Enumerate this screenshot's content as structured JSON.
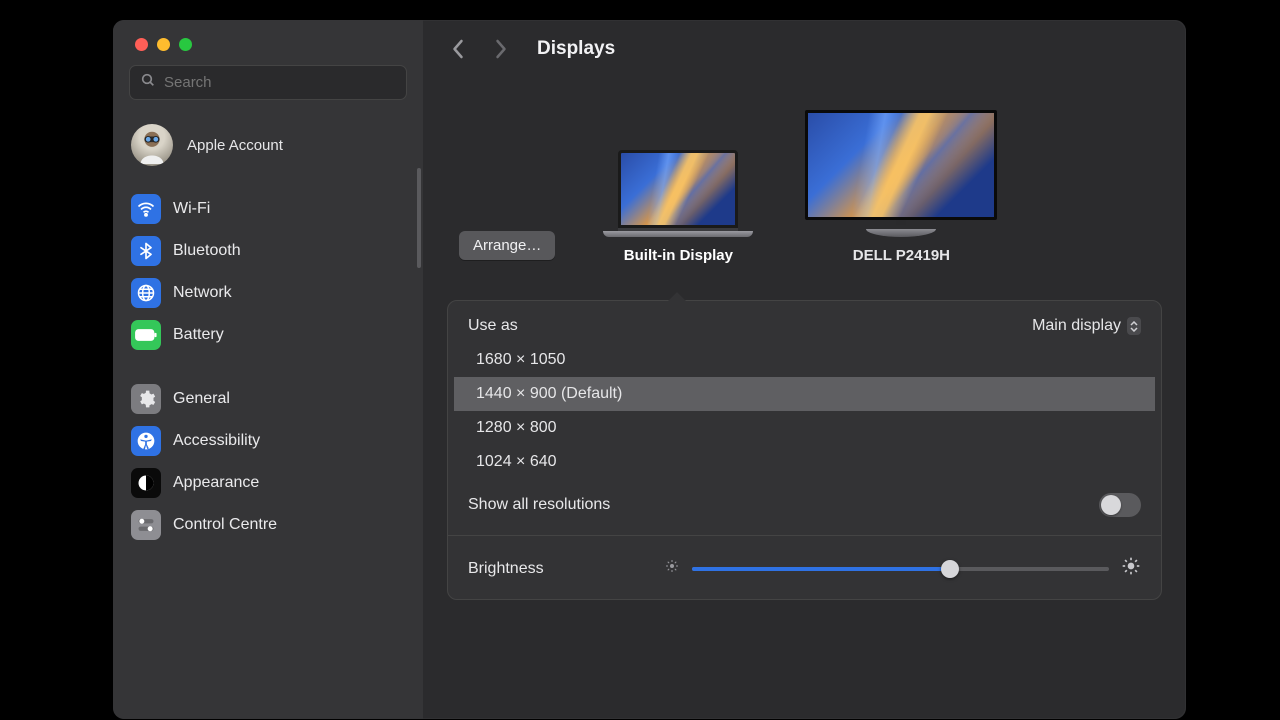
{
  "header": {
    "title": "Displays"
  },
  "search": {
    "placeholder": "Search"
  },
  "account": {
    "label": "Apple Account"
  },
  "sidebar": {
    "group1": [
      {
        "label": "Wi-Fi",
        "icon": "wifi",
        "bg": "#2f72e4"
      },
      {
        "label": "Bluetooth",
        "icon": "bluetooth",
        "bg": "#2f72e4"
      },
      {
        "label": "Network",
        "icon": "globe",
        "bg": "#2f72e4"
      },
      {
        "label": "Battery",
        "icon": "battery",
        "bg": "#34c759"
      }
    ],
    "group2": [
      {
        "label": "General",
        "icon": "gear",
        "bg": "#7c7c80"
      },
      {
        "label": "Accessibility",
        "icon": "access",
        "bg": "#2f72e4"
      },
      {
        "label": "Appearance",
        "icon": "contrast",
        "bg": "#0a0a0a"
      },
      {
        "label": "Control Centre",
        "icon": "switches",
        "bg": "#8e8e93"
      }
    ]
  },
  "displays": {
    "arrange_label": "Arrange…",
    "builtin_label": "Built-in Display",
    "external_label": "DELL P2419H",
    "selected": "builtin"
  },
  "settings": {
    "use_as_label": "Use as",
    "use_as_value": "Main display",
    "resolutions": [
      "1680 × 1050",
      "1440 × 900 (Default)",
      "1280 × 800",
      "1024 × 640"
    ],
    "selected_resolution_index": 1,
    "show_all_label": "Show all resolutions",
    "show_all_enabled": false,
    "brightness_label": "Brightness",
    "brightness_value": 0.62
  }
}
